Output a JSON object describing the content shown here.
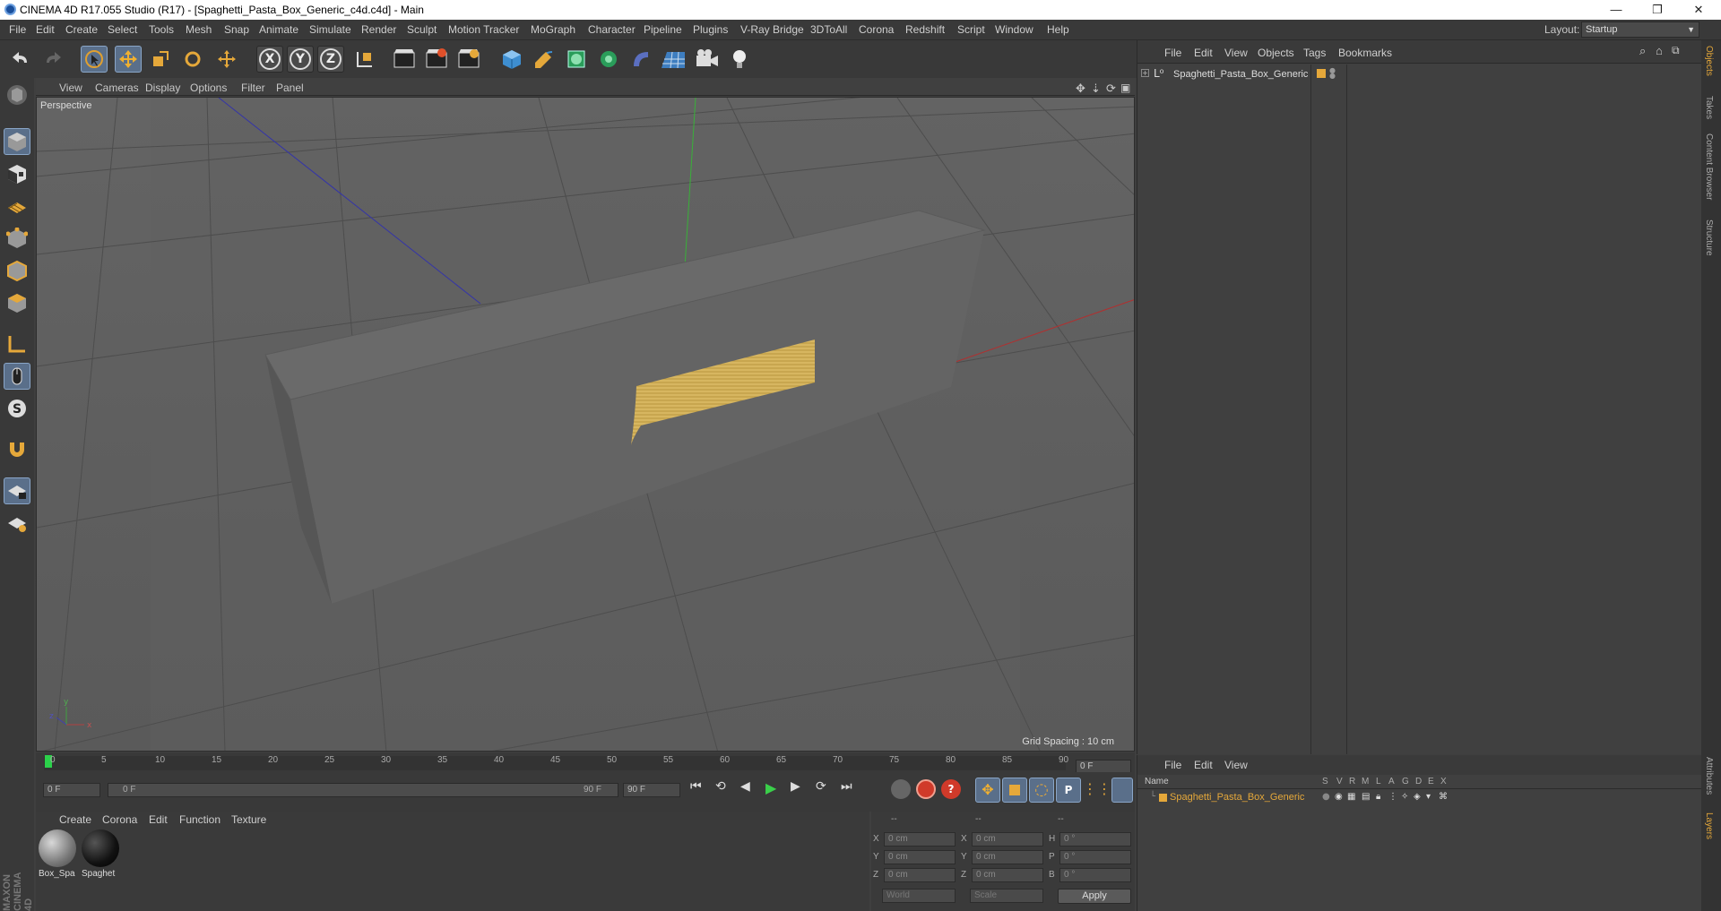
{
  "window": {
    "title": "CINEMA 4D R17.055 Studio (R17) - [Spaghetti_Pasta_Box_Generic_c4d.c4d] - Main",
    "minimize": "—",
    "maximize": "❐",
    "close": "✕"
  },
  "menubar": {
    "items": [
      "File",
      "Edit",
      "Create",
      "Select",
      "Tools",
      "Mesh",
      "Snap",
      "Animate",
      "Simulate",
      "Render",
      "Sculpt",
      "Motion Tracker",
      "MoGraph",
      "Character",
      "Pipeline",
      "Plugins",
      "V-Ray Bridge",
      "3DToAll",
      "Corona",
      "Redshift",
      "Script",
      "Window",
      "Help"
    ],
    "layout_label": "Layout:",
    "layout_value": "Startup"
  },
  "toolbar": {
    "axis_x": "X",
    "axis_y": "Y",
    "axis_z": "Z"
  },
  "viewport": {
    "menu": [
      "View",
      "Cameras",
      "Display",
      "Options",
      "Filter",
      "Panel"
    ],
    "label": "Perspective",
    "grid_spacing": "Grid Spacing : 10 cm"
  },
  "timeline": {
    "ticks": [
      "0",
      "5",
      "10",
      "15",
      "20",
      "25",
      "30",
      "35",
      "40",
      "45",
      "50",
      "55",
      "60",
      "65",
      "70",
      "75",
      "80",
      "85",
      "90"
    ],
    "current_frame": "0 F",
    "start_field": "0 F",
    "range_start": "0 F",
    "range_end": "90 F",
    "end_field": "90 F"
  },
  "materials": {
    "menu": [
      "Create",
      "Corona",
      "Edit",
      "Function",
      "Texture"
    ],
    "items": [
      {
        "name": "Box_Spa"
      },
      {
        "name": "Spaghet"
      }
    ]
  },
  "coords": {
    "headers": [
      "--",
      "--",
      "--"
    ],
    "rows": [
      {
        "a": "X",
        "av": "0 cm",
        "b": "X",
        "bv": "0 cm",
        "c": "H",
        "cv": "0 °"
      },
      {
        "a": "Y",
        "av": "0 cm",
        "b": "Y",
        "bv": "0 cm",
        "c": "P",
        "cv": "0 °"
      },
      {
        "a": "Z",
        "av": "0 cm",
        "b": "Z",
        "bv": "0 cm",
        "c": "B",
        "cv": "0 °"
      }
    ],
    "world": "World",
    "scale": "Scale",
    "apply": "Apply"
  },
  "objects": {
    "menu": [
      "File",
      "Edit",
      "View",
      "Objects",
      "Tags",
      "Bookmarks"
    ],
    "items": [
      "Spaghetti_Pasta_Box_Generic"
    ]
  },
  "layers": {
    "menu": [
      "File",
      "Edit",
      "View"
    ],
    "name_header": "Name",
    "col_headers": [
      "S",
      "V",
      "R",
      "M",
      "L",
      "A",
      "G",
      "D",
      "E",
      "X"
    ],
    "items": [
      "Spaghetti_Pasta_Box_Generic"
    ]
  },
  "side_tabs": [
    "Objects",
    "Takes",
    "Content Browser",
    "Structure",
    "Attributes",
    "Layers"
  ],
  "brand": "MAXON CINEMA 4D",
  "colors": {
    "accent": "#e5a83a",
    "selected_tool": "#5a6f8a"
  }
}
